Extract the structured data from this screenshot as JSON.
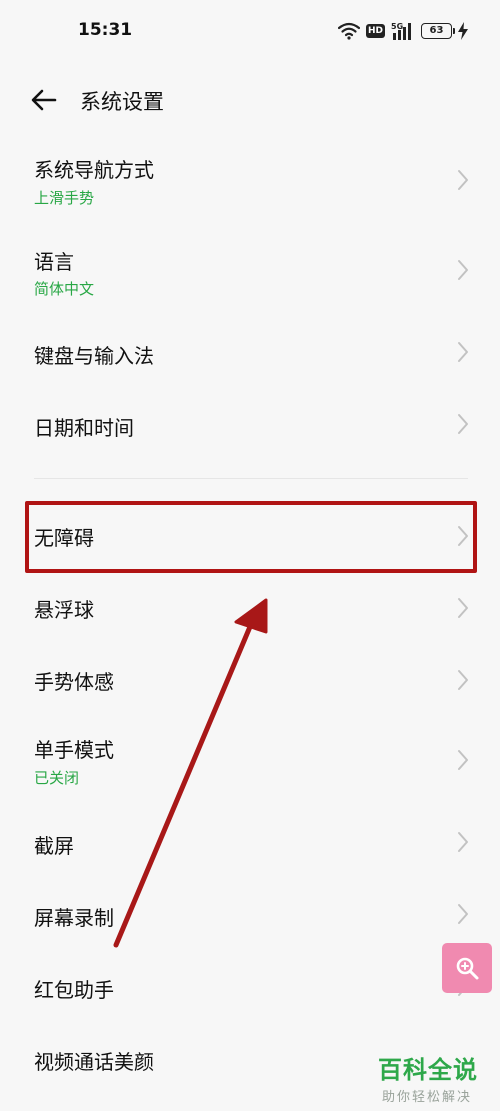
{
  "status_bar": {
    "time": "15:31",
    "hd": "HD",
    "network": "5G",
    "battery": "63"
  },
  "header": {
    "title": "系统设置"
  },
  "items": [
    {
      "title": "系统导航方式",
      "subtitle": "上滑手势"
    },
    {
      "title": "语言",
      "subtitle": "简体中文"
    },
    {
      "title": "键盘与输入法"
    },
    {
      "title": "日期和时间"
    },
    {
      "title": "无障碍"
    },
    {
      "title": "悬浮球"
    },
    {
      "title": "手势体感"
    },
    {
      "title": "单手模式",
      "subtitle": "已关闭"
    },
    {
      "title": "截屏"
    },
    {
      "title": "屏幕录制"
    },
    {
      "title": "红包助手"
    },
    {
      "title": "视频通话美颜"
    }
  ],
  "watermark": {
    "title": "百科全说",
    "subtitle": "助你轻松解决"
  },
  "colors": {
    "accent_green": "#28a745",
    "highlight_red": "#b01414",
    "fab_pink": "#f08ab0"
  }
}
